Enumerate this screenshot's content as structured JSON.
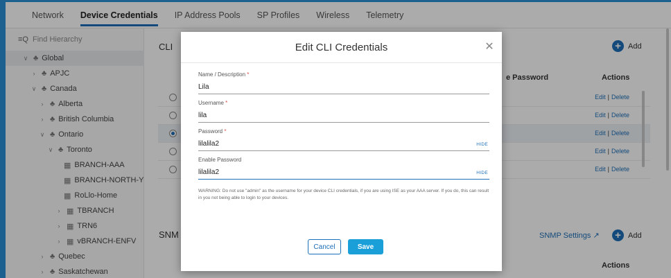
{
  "tabs": [
    {
      "label": "Network"
    },
    {
      "label": "Device Credentials"
    },
    {
      "label": "IP Address Pools"
    },
    {
      "label": "SP Profiles"
    },
    {
      "label": "Wireless"
    },
    {
      "label": "Telemetry"
    }
  ],
  "sidebar": {
    "find_placeholder": "Find Hierarchy",
    "items": [
      {
        "label": "Global",
        "chev": "∨"
      },
      {
        "label": "APJC",
        "chev": "›"
      },
      {
        "label": "Canada",
        "chev": "∨"
      },
      {
        "label": "Alberta",
        "chev": "›"
      },
      {
        "label": "British Columbia",
        "chev": "›"
      },
      {
        "label": "Ontario",
        "chev": "∨"
      },
      {
        "label": "Toronto",
        "chev": "∨"
      },
      {
        "label": "BRANCH-AAA",
        "chev": ""
      },
      {
        "label": "BRANCH-NORTH-YORK",
        "chev": ""
      },
      {
        "label": "RoLlo-Home",
        "chev": ""
      },
      {
        "label": "TBRANCH",
        "chev": "›"
      },
      {
        "label": "TRN6",
        "chev": "›"
      },
      {
        "label": "vBRANCH-ENFV",
        "chev": "›"
      },
      {
        "label": "Quebec",
        "chev": "›"
      },
      {
        "label": "Saskatchewan",
        "chev": "›"
      }
    ]
  },
  "main": {
    "cli_title": "CLI",
    "snmp_title": "SNM",
    "add_label": "Add",
    "add_icon": "+",
    "col_enable_password": "e Password",
    "col_actions": "Actions",
    "row_edit": "Edit",
    "row_sep": "|",
    "row_delete": "Delete",
    "snmp_settings": "SNMP Settings",
    "snmp_settings_icon": "↗",
    "snmp_actions": "Actions"
  },
  "modal": {
    "title": "Edit CLI Credentials",
    "close_icon": "✕",
    "required_mark": "*",
    "name_label": "Name / Description",
    "name_value": "Lila",
    "username_label": "Username",
    "username_value": "lila",
    "password_label": "Password",
    "password_value": "lilalila2",
    "enable_password_label": "Enable Password",
    "enable_password_value": "lilalila2",
    "hide_label": "HIDE",
    "warning": "WARNING: Do not use \"admin\" as the username for your device CLI credentials, if you are using ISE as your AAA server. If you do, this can result in you not being able to login to your devices.",
    "cancel_label": "Cancel",
    "save_label": "Save"
  }
}
